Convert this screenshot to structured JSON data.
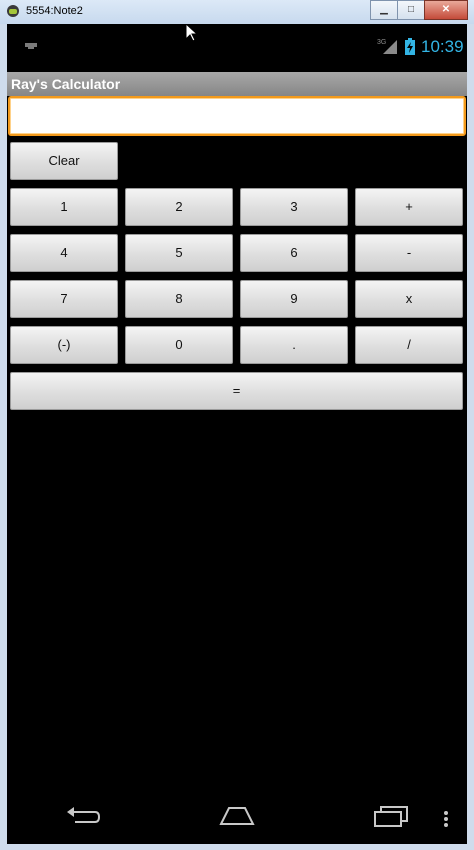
{
  "window": {
    "title": "5554:Note2",
    "minimize_glyph": "▁",
    "maximize_glyph": "□",
    "close_glyph": "✕"
  },
  "status_bar": {
    "network": "3G",
    "time": "10:39",
    "time_color": "#33b5e5"
  },
  "app": {
    "title": "Ray's Calculator",
    "display_value": ""
  },
  "keys": {
    "clear": "Clear",
    "k1": "1",
    "k2": "2",
    "k3": "3",
    "plus": "+",
    "k4": "4",
    "k5": "5",
    "k6": "6",
    "minus": "-",
    "k7": "7",
    "k8": "8",
    "k9": "9",
    "multiply": "x",
    "negate": "(-)",
    "k0": "0",
    "decimal": ".",
    "divide": "/",
    "equals": "="
  },
  "colors": {
    "display_focus_border": "#f39a1c",
    "title_bar": "#9a9a9a"
  },
  "icons": {
    "usb": "usb-debug-icon",
    "signal": "signal-icon",
    "battery": "battery-charging-icon",
    "back": "back-icon",
    "home": "home-icon",
    "recent": "recent-apps-icon",
    "menu": "overflow-menu-icon"
  }
}
